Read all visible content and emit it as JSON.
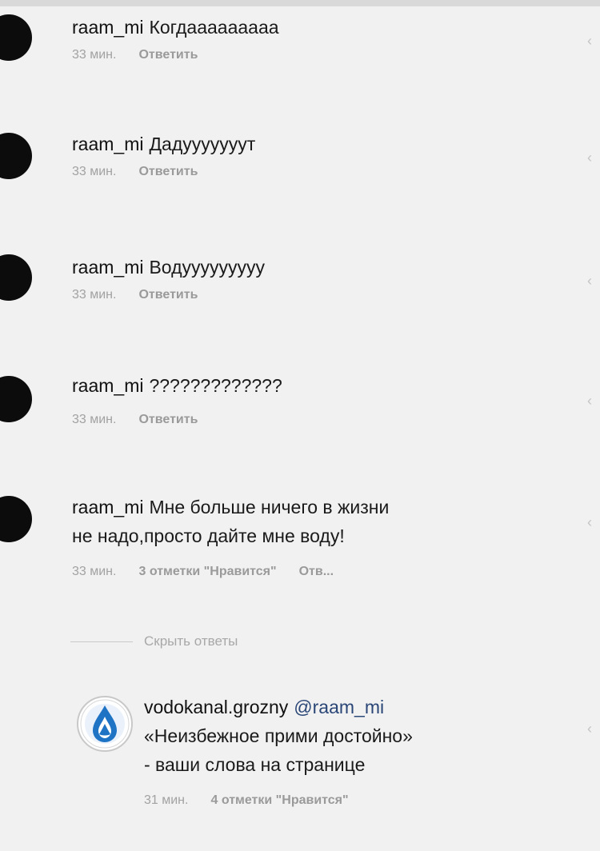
{
  "comments": [
    {
      "username": "raam_mi",
      "text": "Когдааааааааа",
      "time": "33 мин.",
      "reply_label": "Ответить"
    },
    {
      "username": "raam_mi",
      "text": "Дадууууууут",
      "time": "33 мин.",
      "reply_label": "Ответить"
    },
    {
      "username": "raam_mi",
      "text": "Водууууууууу",
      "time": "33 мин.",
      "reply_label": "Ответить"
    },
    {
      "username": "raam_mi",
      "text": "?????????????",
      "time": "33 мин.",
      "reply_label": "Ответить"
    },
    {
      "username": "raam_mi",
      "text_line1": "Мне больше ничего в жизни",
      "text_line2": "не надо,просто дайте мне воду!",
      "time": "33 мин.",
      "likes": "3 отметки \"Нравится\"",
      "reply_label": "Отв..."
    }
  ],
  "hide_replies_label": "Скрыть ответы",
  "reply": {
    "username": "vodokanal.grozny",
    "mention": "@raam_mi",
    "line2": "«Неизбежное прими достойно»",
    "line3": "- ваши слова на странице",
    "time": "31 мин.",
    "likes": "4 отметки \"Нравится\""
  },
  "icons": {
    "like": "heart-icon",
    "avatar": "user-avatar",
    "brand": "vodokanal-logo"
  },
  "colors": {
    "background": "#f1f1f1",
    "username": "#111111",
    "meta": "#9a9a9a",
    "mention": "#2a4677"
  }
}
